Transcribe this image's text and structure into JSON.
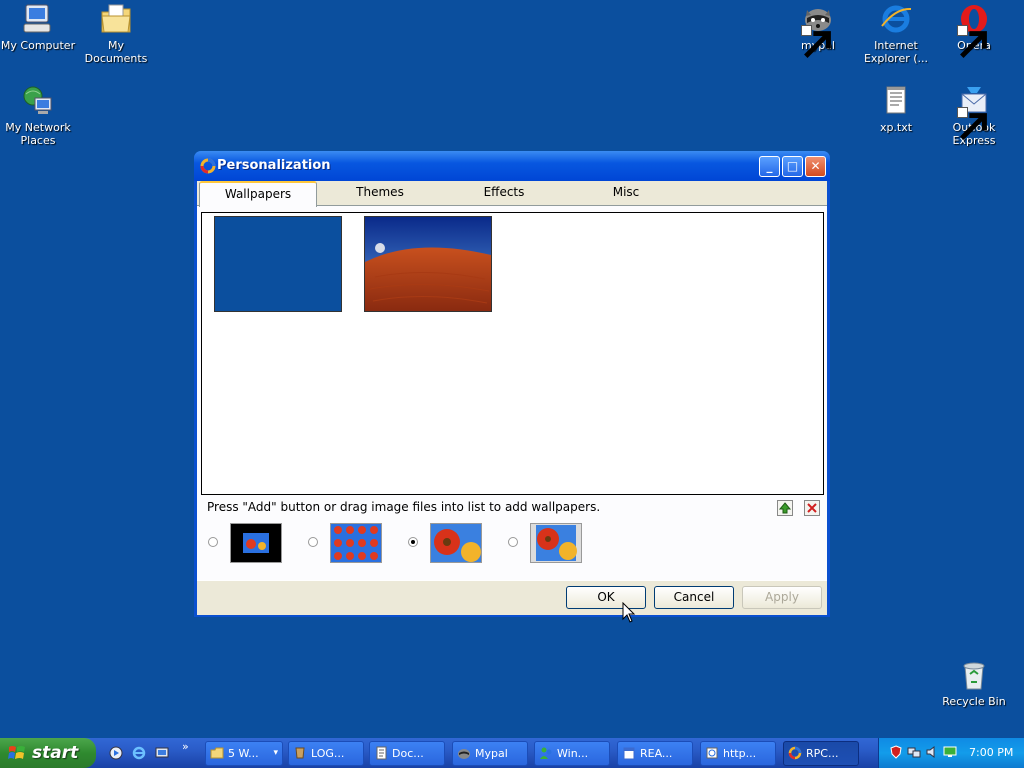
{
  "desktop": {
    "background": "#0b4f9e",
    "icons": [
      {
        "label": "My Computer",
        "icon": "computer-icon"
      },
      {
        "label": "My Documents",
        "icon": "folder-documents-icon"
      },
      {
        "label": "My Network Places",
        "icon": "network-icon"
      },
      {
        "label": "mypal",
        "icon": "raccoon-icon"
      },
      {
        "label": "Internet Explorer (...",
        "icon": "internet-explorer-icon"
      },
      {
        "label": "Opera",
        "icon": "opera-icon"
      },
      {
        "label": "xp.txt",
        "icon": "text-file-icon"
      },
      {
        "label": "Outlook Express",
        "icon": "outlook-icon"
      },
      {
        "label": "Recycle Bin",
        "icon": "recycle-bin-icon"
      }
    ]
  },
  "window": {
    "title": "Personalization",
    "tabs": [
      "Wallpapers",
      "Themes",
      "Effects",
      "Misc"
    ],
    "active_tab": "Wallpapers",
    "hint": "Press \"Add\" button or drag image files into list to add wallpapers.",
    "position_modes": [
      {
        "id": "center",
        "checked": false
      },
      {
        "id": "tile",
        "checked": false
      },
      {
        "id": "stretch",
        "checked": true
      },
      {
        "id": "fit",
        "checked": false
      }
    ],
    "buttons": {
      "ok": "OK",
      "cancel": "Cancel",
      "apply": "Apply"
    }
  },
  "taskbar": {
    "start_label": "start",
    "tasks": [
      "5 W...",
      "LOG...",
      "Doc...",
      "Mypal",
      "Win...",
      "REA...",
      "http...",
      "RPC..."
    ],
    "clock": "7:00 PM"
  }
}
